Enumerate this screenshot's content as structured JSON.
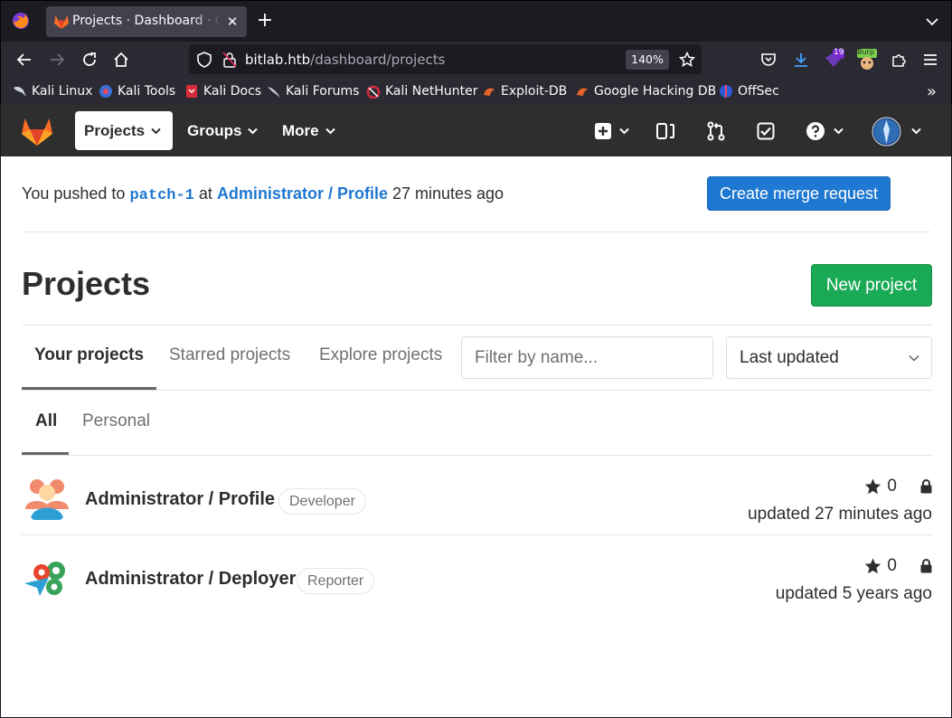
{
  "browser": {
    "tab_title": "Projects · Dashboard · GitLab",
    "url_host": "bitlab.htb",
    "url_path": "/dashboard/projects",
    "zoom": "140%",
    "ext_badge_count": "19",
    "ext_burp_label": "Burp",
    "bookmarks": [
      "Kali Linux",
      "Kali Tools",
      "Kali Docs",
      "Kali Forums",
      "Kali NetHunter",
      "Exploit-DB",
      "Google Hacking DB",
      "OffSec"
    ]
  },
  "gitlab_header": {
    "nav": [
      "Projects",
      "Groups",
      "More"
    ]
  },
  "push_notice": {
    "prefix": "You pushed to",
    "branch": "patch-1",
    "at": "at",
    "project": "Administrator / Profile",
    "time": "27 minutes ago",
    "button": "Create merge request"
  },
  "page": {
    "title": "Projects",
    "new_project_button": "New project"
  },
  "tabs": [
    "Your projects",
    "Starred projects",
    "Explore projects"
  ],
  "filter_placeholder": "Filter by name...",
  "sort_selected": "Last updated",
  "subtabs": [
    "All",
    "Personal"
  ],
  "projects": [
    {
      "name": "Administrator / Profile",
      "role": "Developer",
      "stars": "0",
      "updated": "updated 27 minutes ago"
    },
    {
      "name": "Administrator / Deployer",
      "role": "Reporter",
      "stars": "0",
      "updated": "updated 5 years ago"
    }
  ],
  "colors": {
    "gitlab_header": "#2e2e2e",
    "link_blue": "#1f78d1",
    "success_green": "#1aaa55"
  }
}
